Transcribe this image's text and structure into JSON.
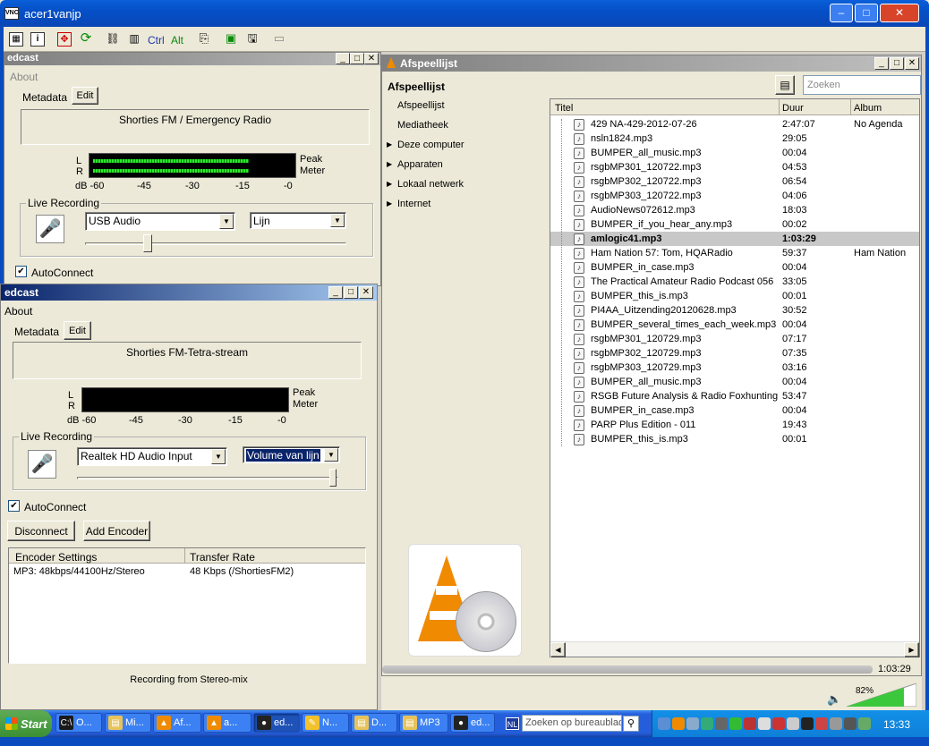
{
  "main_window": {
    "title": "acer1vanjp",
    "min": "–",
    "max": "□",
    "close": "✕"
  },
  "toolbar": {
    "ctrl": "Ctrl",
    "alt": "Alt"
  },
  "edcast1": {
    "title": "edcast",
    "about": "About",
    "metadata_label": "Metadata",
    "edit": "Edit",
    "metadata_value": "Shorties FM / Emergency Radio",
    "l": "L",
    "r": "R",
    "peak": "Peak",
    "meter": "Meter",
    "scale": [
      "dB -60",
      "-45",
      "-30",
      "-15",
      "-0"
    ],
    "live_recording": "Live Recording",
    "device": "USB Audio",
    "input": "Lijn",
    "autoconnect": "AutoConnect",
    "level_left": 0.87,
    "level_right": 0.87,
    "slider": 0.24
  },
  "edcast2": {
    "title": "edcast",
    "about": "About",
    "metadata_label": "Metadata",
    "edit": "Edit",
    "metadata_value": "Shorties FM-Tetra-stream",
    "l": "L",
    "r": "R",
    "peak": "Peak",
    "meter": "Meter",
    "scale": [
      "dB -60",
      "-45",
      "-30",
      "-15",
      "-0"
    ],
    "live_recording": "Live Recording",
    "device": "Realtek HD Audio Input",
    "input": "Volume van lijn",
    "autoconnect": "AutoConnect",
    "disconnect": "Disconnect",
    "add_encoder": "Add Encoder",
    "col_settings": "Encoder Settings",
    "col_rate": "Transfer Rate",
    "encoder_setting": "MP3: 48kbps/44100Hz/Stereo",
    "encoder_rate": "48 Kbps (/ShortiesFM2)",
    "status": "Recording from Stereo-mix",
    "slider": 0.98
  },
  "vlc": {
    "title": "Afspeellijst",
    "search_placeholder": "Zoeken",
    "sidebar": {
      "header": "Afspeellijst",
      "items": [
        "Afspeellijst",
        "Mediatheek"
      ],
      "sections": [
        "Deze computer",
        "Apparaten",
        "Lokaal netwerk",
        "Internet"
      ]
    },
    "columns": [
      "Titel",
      "Duur",
      "Album"
    ],
    "rows": [
      {
        "title": "429 NA-429-2012-07-26",
        "duration": "2:47:07",
        "album": "No Agenda"
      },
      {
        "title": "nsln1824.mp3",
        "duration": "29:05",
        "album": ""
      },
      {
        "title": "BUMPER_all_music.mp3",
        "duration": "00:04",
        "album": ""
      },
      {
        "title": "rsgbMP301_120722.mp3",
        "duration": "04:53",
        "album": ""
      },
      {
        "title": "rsgbMP302_120722.mp3",
        "duration": "06:54",
        "album": ""
      },
      {
        "title": "rsgbMP303_120722.mp3",
        "duration": "04:06",
        "album": ""
      },
      {
        "title": "AudioNews072612.mp3",
        "duration": "18:03",
        "album": ""
      },
      {
        "title": "BUMPER_if_you_hear_any.mp3",
        "duration": "00:02",
        "album": ""
      },
      {
        "title": "amlogic41.mp3",
        "duration": "1:03:29",
        "album": "",
        "playing": true
      },
      {
        "title": "Ham Nation 57: Tom, HQARadio",
        "duration": "59:37",
        "album": "Ham Nation"
      },
      {
        "title": "BUMPER_in_case.mp3",
        "duration": "00:04",
        "album": ""
      },
      {
        "title": "The Practical Amateur Radio Podcast 056",
        "duration": "33:05",
        "album": ""
      },
      {
        "title": "BUMPER_this_is.mp3",
        "duration": "00:01",
        "album": ""
      },
      {
        "title": "PI4AA_Uitzending20120628.mp3",
        "duration": "30:52",
        "album": ""
      },
      {
        "title": "BUMPER_several_times_each_week.mp3",
        "duration": "00:04",
        "album": ""
      },
      {
        "title": "rsgbMP301_120729.mp3",
        "duration": "07:17",
        "album": ""
      },
      {
        "title": "rsgbMP302_120729.mp3",
        "duration": "07:35",
        "album": ""
      },
      {
        "title": "rsgbMP303_120729.mp3",
        "duration": "03:16",
        "album": ""
      },
      {
        "title": "BUMPER_all_music.mp3",
        "duration": "00:04",
        "album": ""
      },
      {
        "title": "RSGB Future Analysis & Radio Foxhunting",
        "duration": "53:47",
        "album": ""
      },
      {
        "title": "BUMPER_in_case.mp3",
        "duration": "00:04",
        "album": ""
      },
      {
        "title": "PARP Plus Edition - 011",
        "duration": "19:43",
        "album": ""
      },
      {
        "title": "BUMPER_this_is.mp3",
        "duration": "00:01",
        "album": ""
      }
    ],
    "time": "1:03:29",
    "volume": "82%",
    "volume_level": 0.82
  },
  "taskbar": {
    "start": "Start",
    "items": [
      {
        "label": "O...",
        "color": "#1a1a1a",
        "glyph": "C:\\"
      },
      {
        "label": "Mi...",
        "color": "#e8c35a",
        "glyph": "▤"
      },
      {
        "label": "Af...",
        "color": "#f08a00",
        "glyph": "▲"
      },
      {
        "label": "a...",
        "color": "#f08a00",
        "glyph": "▲"
      },
      {
        "label": "ed...",
        "color": "#222",
        "glyph": "●"
      },
      {
        "label": "N...",
        "color": "#f3c12b",
        "glyph": "✎"
      },
      {
        "label": "D...",
        "color": "#e8c35a",
        "glyph": "▤"
      },
      {
        "label": "MP3",
        "color": "#e8c35a",
        "glyph": "▤"
      },
      {
        "label": "ed...",
        "color": "#222",
        "glyph": "●"
      }
    ],
    "lang": "NL",
    "search_placeholder": "Zoeken op bureaublad",
    "clock": "13:33"
  }
}
